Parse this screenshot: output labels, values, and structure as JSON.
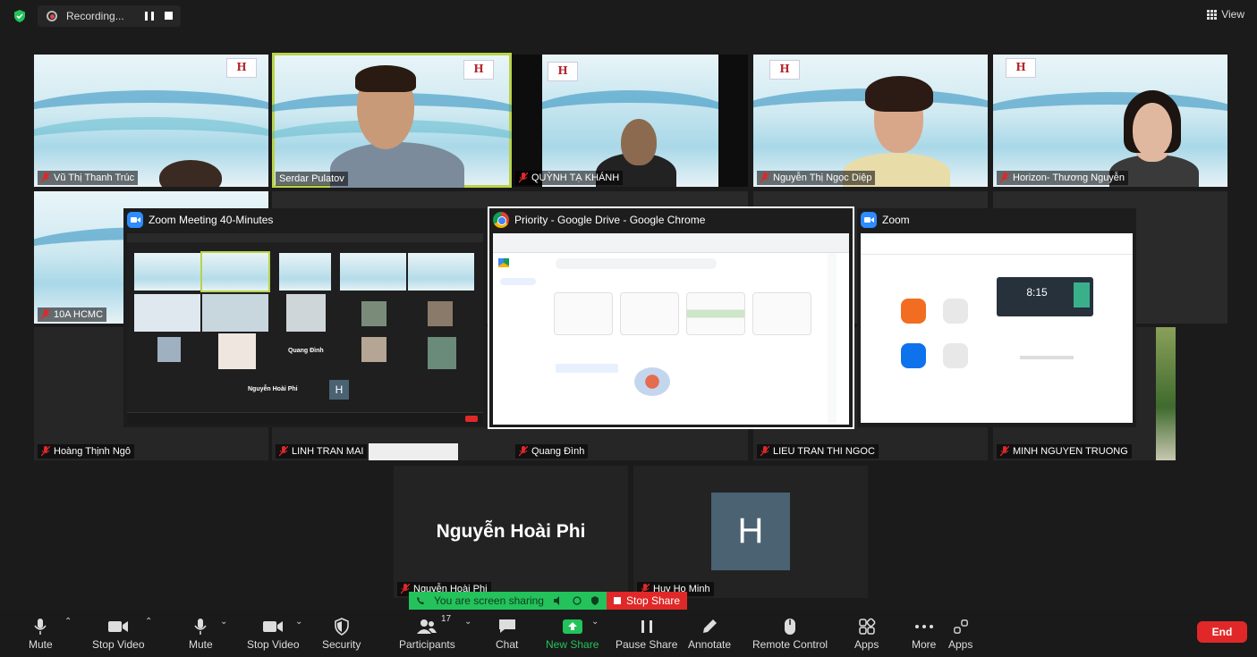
{
  "top_bar": {
    "recording_label": "Recording...",
    "view_label": "View"
  },
  "participants": [
    {
      "name": "Vũ Thị Thanh Trúc",
      "muted": true
    },
    {
      "name": "Serdar Pulatov",
      "muted": false
    },
    {
      "name": "QUỲNH TẠ KHÁNH",
      "muted": true
    },
    {
      "name": "Nguyễn Thị Ngọc Diệp",
      "muted": true
    },
    {
      "name": "Horizon- Thương Nguyễn",
      "muted": true
    },
    {
      "name": "10A HCMC",
      "muted": true
    },
    {
      "name": "Hoàng Thịnh Ngô",
      "muted": true
    },
    {
      "name": "LINH TRAN MAI",
      "muted": true
    },
    {
      "name": "Quang Đình",
      "muted": true
    },
    {
      "name": "LIEU TRAN THI NGOC",
      "muted": true
    },
    {
      "name": "MINH NGUYEN TRUONG",
      "muted": true
    },
    {
      "name": "Nguyễn Hoài Phi",
      "muted": true
    },
    {
      "name": "Huy Ho Minh",
      "muted": true
    }
  ],
  "big_tiles": {
    "phi_display_name": "Nguyễn Hoài Phi",
    "huy_avatar_letter": "H"
  },
  "shared_windows": {
    "zoom_meeting_title": "Zoom Meeting 40-Minutes",
    "chrome_title": "Priority - Google Drive - Google Chrome",
    "zoom_title": "Zoom",
    "zoom_clock": "8:15",
    "inner_name": "Nguyễn Hoài Phi",
    "inner_name2": "Quang Đình",
    "inner_avatar": "H"
  },
  "share_banner": {
    "status_text": "You are screen sharing",
    "stop_label": "Stop Share"
  },
  "toolbar": {
    "mute": "Mute",
    "stop_video": "Stop Video",
    "mute2": "Mute",
    "stop_video2": "Stop Video",
    "security": "Security",
    "participants": "Participants",
    "participant_count": "17",
    "chat": "Chat",
    "new_share": "New Share",
    "pause_share": "Pause Share",
    "annotate": "Annotate",
    "remote_control": "Remote Control",
    "apps": "Apps",
    "more": "More",
    "apps_partial": "Apps",
    "end": "End"
  },
  "colors": {
    "accent_green": "#23c25b",
    "end_red": "#e02828",
    "active_speaker": "#b9d34a",
    "zoom_blue": "#2d8cff"
  }
}
